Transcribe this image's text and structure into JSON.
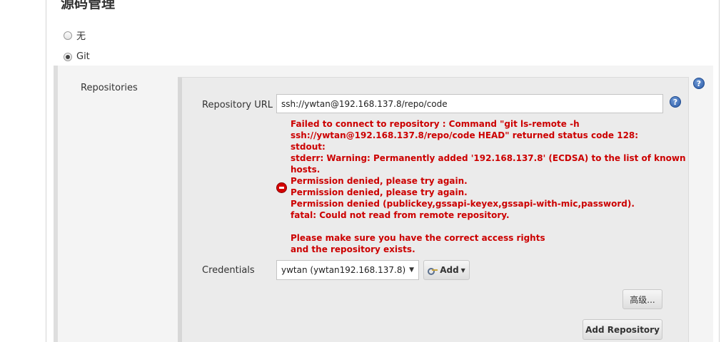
{
  "section": {
    "title": "源码管理"
  },
  "scm_options": [
    {
      "label": "无",
      "selected": false
    },
    {
      "label": "Git",
      "selected": true
    }
  ],
  "git": {
    "repositories_label": "Repositories",
    "repository_url_label": "Repository URL",
    "repository_url_value": "ssh://ywtan@192.168.137.8/repo/code",
    "error_lines": [
      "Failed to connect to repository : Command \"git ls-remote -h",
      "ssh://ywtan@192.168.137.8/repo/code HEAD\" returned status code 128:",
      "stdout:",
      "stderr: Warning: Permanently added '192.168.137.8' (ECDSA) to the list of known",
      "hosts.",
      "Permission denied, please try again.",
      "Permission denied, please try again.",
      "Permission denied (publickey,gssapi-keyex,gssapi-with-mic,password).",
      "fatal: Could not read from remote repository.",
      "",
      "Please make sure you have the correct access rights",
      "and the repository exists."
    ],
    "credentials_label": "Credentials",
    "credentials_selected": "ywtan (ywtan192.168.137.8)",
    "add_label": "Add",
    "advanced_label": "高级...",
    "add_repository_label": "Add Repository",
    "help_glyph": "?"
  },
  "icons": {
    "help": "help-icon",
    "error": "error-icon",
    "key": "key-icon"
  },
  "colors": {
    "error_text": "#cc0000",
    "help_blue": "#2b5aa6"
  }
}
